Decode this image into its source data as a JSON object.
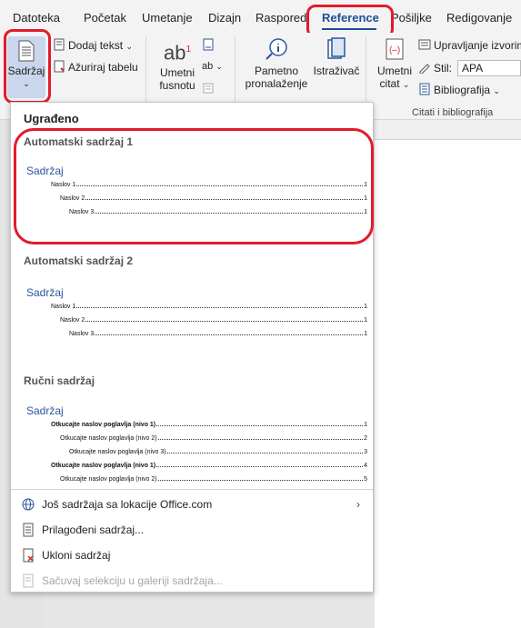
{
  "tabs": [
    "Datoteka",
    "Početak",
    "Umetanje",
    "Dizajn",
    "Raspored",
    "Reference",
    "Pošiljke",
    "Redigovanje"
  ],
  "active_tab": "Reference",
  "ribbon": {
    "toc_button": "Sadržaj",
    "add_text": "Dodaj tekst",
    "update_table": "Ažuriraj tabelu",
    "insert_footnote_1": "Umetni",
    "insert_footnote_2": "fusnotu",
    "smart_lookup_1": "Pametno",
    "smart_lookup_2": "pronalaženje",
    "researcher": "Istraživač",
    "insert_citation_1": "Umetni",
    "insert_citation_2": "citat",
    "manage_sources": "Upravljanje izvorima",
    "style_label": "Stil:",
    "style_value": "APA",
    "bibliography": "Bibliografija",
    "group_citations": "Citati i bibliografija"
  },
  "gallery": {
    "header": "Ugrađeno",
    "auto1_title": "Automatski sadržaj 1",
    "auto2_title": "Automatski sadržaj 2",
    "manual_title": "Ručni sadržaj",
    "toc_heading": "Sadržaj",
    "auto_lines": [
      {
        "label": "Naslov 1",
        "page": "1"
      },
      {
        "label": "Naslov 2",
        "page": "1"
      },
      {
        "label": "Naslov 3",
        "page": "1"
      }
    ],
    "manual_lines": [
      {
        "label": "Otkucajte naslov poglavlja (nivo 1)",
        "page": "1"
      },
      {
        "label": "Otkucajte naslov poglavlja (nivo 2)",
        "page": "2"
      },
      {
        "label": "Otkucajte naslov poglavlja (nivo 3)",
        "page": "3"
      },
      {
        "label": "Otkucajte naslov poglavlja (nivo 1)",
        "page": "4"
      },
      {
        "label": "Otkucajte naslov poglavlja (nivo 2)",
        "page": "5"
      }
    ],
    "menu": {
      "more_office": "Još sadržaja sa lokacije Office.com",
      "custom": "Prilagođeni sadržaj...",
      "remove": "Ukloni sadržaj",
      "save_selection": "Sačuvaj selekciju u galeriji sadržaja..."
    }
  },
  "colors": {
    "accent": "#1f4e99",
    "highlight": "#e21b2b",
    "toc_heading": "#2b579a"
  }
}
